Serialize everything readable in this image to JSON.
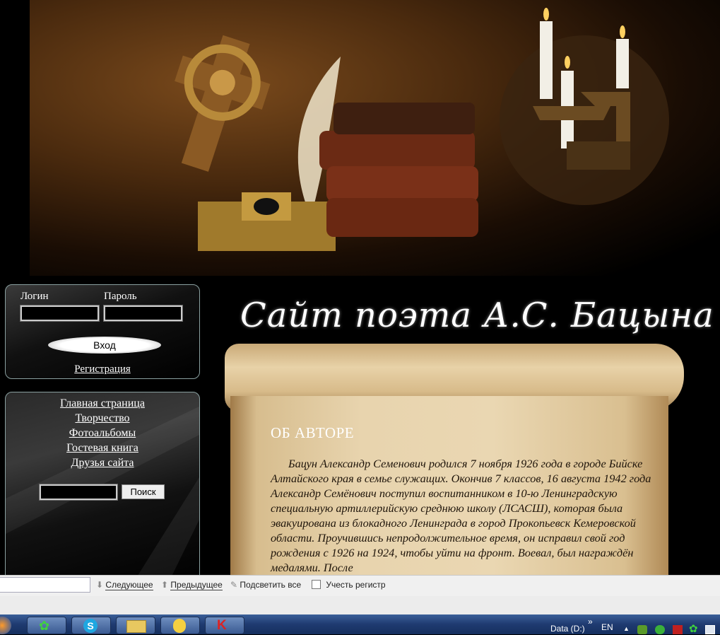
{
  "login": {
    "login_label": "Логин",
    "password_label": "Пароль",
    "submit_label": "Вход",
    "register_link": "Регистрация"
  },
  "nav": {
    "items": [
      {
        "label": "Главная страница"
      },
      {
        "label": "Творчество"
      },
      {
        "label": "Фотоальбомы"
      },
      {
        "label": "Гостевая книга"
      },
      {
        "label": "Друзья сайта"
      }
    ]
  },
  "search": {
    "button_label": "Поиск"
  },
  "site_title": "Сайт поэта А.С. Бацына",
  "content": {
    "heading": "ОБ АВТОРЕ",
    "bio": "Бацун Александр Семенович родился 7 ноября 1926 года в городе Бийске Алтайского края в семье служащих. Окончив 7 классов, 16 августа 1942 года Александр Семёнович поступил воспитанником в 10-ю Ленинградскую специальную артиллерийскую среднюю школу (ЛСАСШ), которая была эвакуирована из блокадного Ленинграда в город Прокопьевск Кемеровской области. Проучившись непродолжительное время, он исправил свой год рождения с 1926 на 1924, чтобы уйти на фронт. Воевал, был награждён медалями. После"
  },
  "findbar": {
    "next_label": "Следующее",
    "prev_label": "Предыдущее",
    "highlight_label": "Подсветить все",
    "match_case_label": "Учесть регистр"
  },
  "taskbar": {
    "drive_label": "Data (D:)",
    "lang": "EN",
    "chevron": "»"
  },
  "colors": {
    "parchment": "#e8d4ae",
    "taskbar": "#1f3a70",
    "panel_border": "#8aa0a0"
  }
}
